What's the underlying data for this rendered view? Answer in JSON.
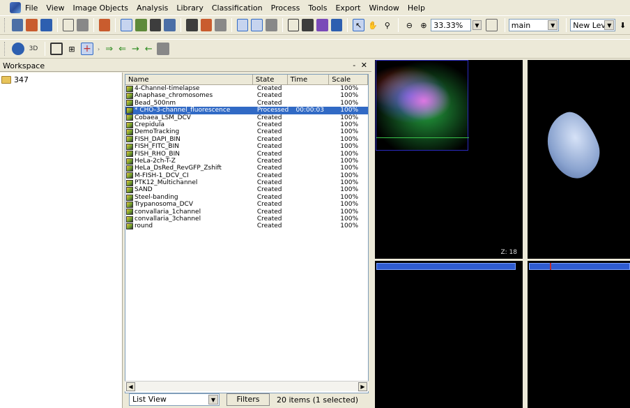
{
  "menubar": {
    "items": [
      "File",
      "View",
      "Image Objects",
      "Analysis",
      "Library",
      "Classification",
      "Process",
      "Tools",
      "Export",
      "Window",
      "Help"
    ]
  },
  "toolbar": {
    "zoom": "33.33%",
    "map_combo": "main",
    "level_combo": "New Level"
  },
  "workspace": {
    "title": "Workspace",
    "root_item": "347"
  },
  "list": {
    "headers": [
      "Name",
      "State",
      "Time",
      "Scale"
    ],
    "rows": [
      {
        "name": "4-Channel-timelapse",
        "state": "Created",
        "time": "",
        "scale": "100%"
      },
      {
        "name": "Anaphase_chromosomes",
        "state": "Created",
        "time": "",
        "scale": "100%"
      },
      {
        "name": "Bead_500nm",
        "state": "Created",
        "time": "",
        "scale": "100%"
      },
      {
        "name": "* CHO-3-channel_fluorescence",
        "state": "Processed",
        "time": "00:00:03",
        "scale": "100%"
      },
      {
        "name": "Cobaea_LSM_DCV",
        "state": "Created",
        "time": "",
        "scale": "100%"
      },
      {
        "name": "Crepidula",
        "state": "Created",
        "time": "",
        "scale": "100%"
      },
      {
        "name": "DemoTracking",
        "state": "Created",
        "time": "",
        "scale": "100%"
      },
      {
        "name": "FISH_DAPI_BIN",
        "state": "Created",
        "time": "",
        "scale": "100%"
      },
      {
        "name": "FISH_FITC_BIN",
        "state": "Created",
        "time": "",
        "scale": "100%"
      },
      {
        "name": "FISH_RHO_BIN",
        "state": "Created",
        "time": "",
        "scale": "100%"
      },
      {
        "name": "HeLa-2ch-T-Z",
        "state": "Created",
        "time": "",
        "scale": "100%"
      },
      {
        "name": "HeLa_DsRed_RevGFP_Zshift",
        "state": "Created",
        "time": "",
        "scale": "100%"
      },
      {
        "name": "M-FISH-1_DCV_CI",
        "state": "Created",
        "time": "",
        "scale": "100%"
      },
      {
        "name": "PTK12_Multichannel",
        "state": "Created",
        "time": "",
        "scale": "100%"
      },
      {
        "name": "SAND",
        "state": "Created",
        "time": "",
        "scale": "100%"
      },
      {
        "name": "Steel-banding",
        "state": "Created",
        "time": "",
        "scale": "100%"
      },
      {
        "name": "Trypanosoma_DCV",
        "state": "Created",
        "time": "",
        "scale": "100%"
      },
      {
        "name": "convallaria_1channel",
        "state": "Created",
        "time": "",
        "scale": "100%"
      },
      {
        "name": "convallaria_3channel",
        "state": "Created",
        "time": "",
        "scale": "100%"
      },
      {
        "name": "round",
        "state": "Created",
        "time": "",
        "scale": "100%"
      }
    ],
    "selected_index": 3
  },
  "footer": {
    "view_mode": "List View",
    "filters_label": "Filters",
    "count_text": "20 items (1 selected)"
  },
  "viewer": {
    "z_label": "Z: 18"
  }
}
